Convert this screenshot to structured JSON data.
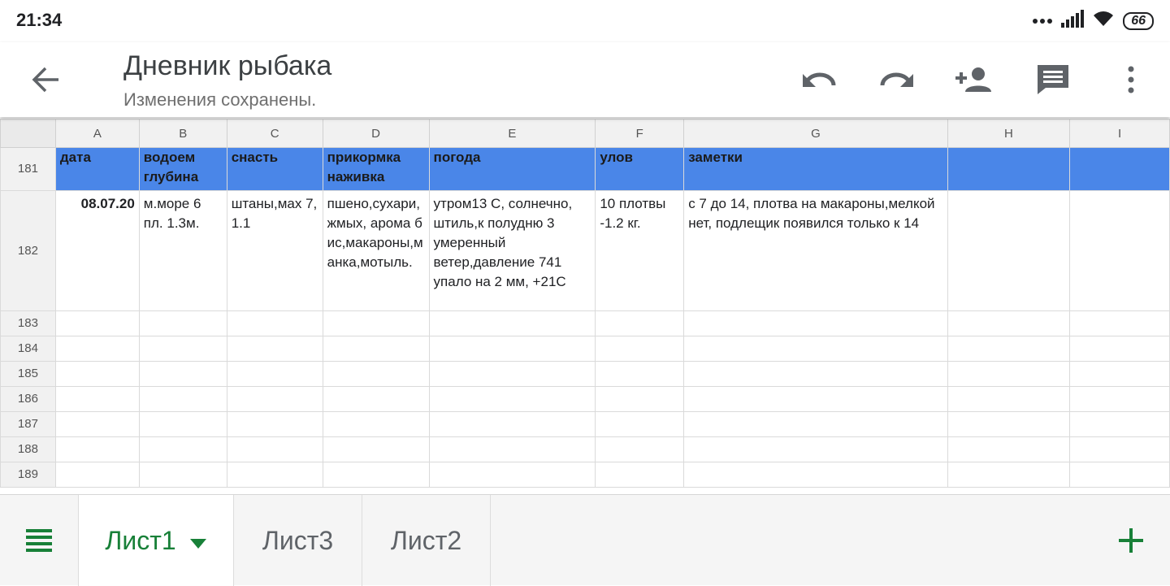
{
  "status_bar": {
    "time": "21:34",
    "battery": "66"
  },
  "app_bar": {
    "title": "Дневник рыбака",
    "subtitle": "Изменения сохранены."
  },
  "sheet": {
    "columns": [
      "A",
      "B",
      "C",
      "D",
      "E",
      "F",
      "G",
      "H",
      "I"
    ],
    "header_row": {
      "num": "181",
      "cells": [
        "дата",
        "водоем глубина",
        "снасть",
        "прикормка наживка",
        "погода",
        "улов",
        "заметки",
        "",
        ""
      ]
    },
    "data_row": {
      "num": "182",
      "cells": [
        "08.07.20",
        "м.море 6 пл. 1.3м.",
        "штаны,мах 7, 1.1",
        "пшено,сухари,жмых, арома бис,макароны,манка,мотыль.",
        "утром13 С, солнечно, штиль,к полудню 3 умеренный ветер,давление 741 упало на 2 мм, +21С",
        "10 плотвы -1.2 кг.",
        "с 7 до 14, плотва на макароны,мелкой нет, подлещик появился только к 14",
        "",
        ""
      ]
    },
    "empty_rows": [
      "183",
      "184",
      "185",
      "186",
      "187",
      "188",
      "189"
    ]
  },
  "tabs": [
    {
      "label": "Лист1",
      "active": true
    },
    {
      "label": "Лист3",
      "active": false
    },
    {
      "label": "Лист2",
      "active": false
    }
  ],
  "colors": {
    "header_fill": "#4a86e8",
    "accent": "#188038"
  }
}
